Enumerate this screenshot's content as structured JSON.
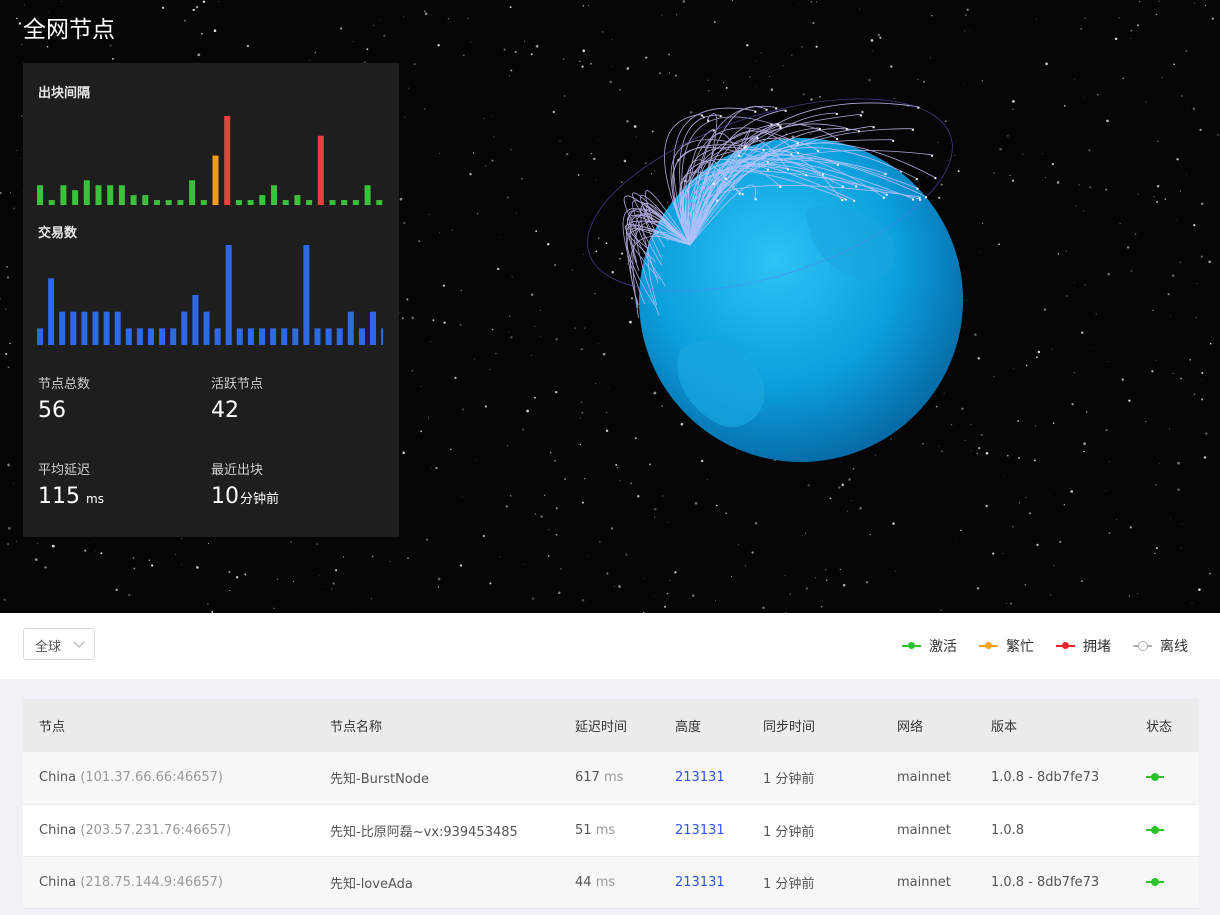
{
  "page": {
    "title": "全网节点"
  },
  "stats": {
    "block_interval_label": "出块间隔",
    "tx_count_label": "交易数",
    "total_nodes_label": "节点总数",
    "total_nodes": "56",
    "active_nodes_label": "活跃节点",
    "active_nodes": "42",
    "avg_latency_label": "平均延迟",
    "avg_latency": "115",
    "avg_latency_unit": "ms",
    "last_block_label": "最近出块",
    "last_block": "10",
    "last_block_unit": "分钟前"
  },
  "chart_data": [
    {
      "type": "bar",
      "title": "出块间隔",
      "values": [
        4,
        1,
        4,
        3,
        5,
        4,
        4,
        4,
        2,
        2,
        1,
        1,
        1,
        5,
        1,
        10,
        18,
        1,
        1,
        2,
        4,
        1,
        2,
        1,
        14,
        1,
        1,
        1,
        4,
        1
      ],
      "status": [
        "g",
        "g",
        "g",
        "g",
        "g",
        "g",
        "g",
        "g",
        "g",
        "g",
        "g",
        "g",
        "g",
        "g",
        "g",
        "o",
        "r",
        "g",
        "g",
        "g",
        "g",
        "g",
        "g",
        "g",
        "r",
        "g",
        "g",
        "g",
        "g",
        "g"
      ],
      "colors": {
        "g": "#3cc13c",
        "o": "#f09a1c",
        "r": "#e8413f"
      }
    },
    {
      "type": "bar",
      "title": "交易数",
      "values": [
        2,
        8,
        4,
        4,
        4,
        4,
        4,
        4,
        2,
        2,
        2,
        2,
        2,
        4,
        6,
        4,
        2,
        12,
        2,
        2,
        2,
        2,
        2,
        2,
        12,
        2,
        2,
        2,
        4,
        2,
        4,
        2
      ],
      "color": "#2f6ae6"
    }
  ],
  "filter": {
    "region": "全球"
  },
  "legend": [
    {
      "label": "激活",
      "color": "#2cc22c",
      "hollow": false
    },
    {
      "label": "繁忙",
      "color": "#f5a11c",
      "hollow": false
    },
    {
      "label": "拥堵",
      "color": "#e8232a",
      "hollow": false
    },
    {
      "label": "离线",
      "color": "#b0b0b0",
      "hollow": true
    }
  ],
  "table": {
    "headers": [
      "节点",
      "节点名称",
      "延迟时间",
      "高度",
      "同步时间",
      "网络",
      "版本",
      "状态"
    ],
    "rows": [
      {
        "country": "China",
        "ip": "(101.37.66.66:46657)",
        "name": "先知-BurstNode",
        "latency": "617",
        "latency_unit": "ms",
        "height": "213131",
        "sync": "1 分钟前",
        "network": "mainnet",
        "version": "1.0.8 - 8db7fe73"
      },
      {
        "country": "China",
        "ip": "(203.57.231.76:46657)",
        "name": "先知-比原阿磊~vx:939453485",
        "latency": "51",
        "latency_unit": "ms",
        "height": "213131",
        "sync": "1 分钟前",
        "network": "mainnet",
        "version": "1.0.8"
      },
      {
        "country": "China",
        "ip": "(218.75.144.9:46657)",
        "name": "先知-loveAda",
        "latency": "44",
        "latency_unit": "ms",
        "height": "213131",
        "sync": "1 分钟前",
        "network": "mainnet",
        "version": "1.0.8 - 8db7fe73"
      }
    ]
  }
}
